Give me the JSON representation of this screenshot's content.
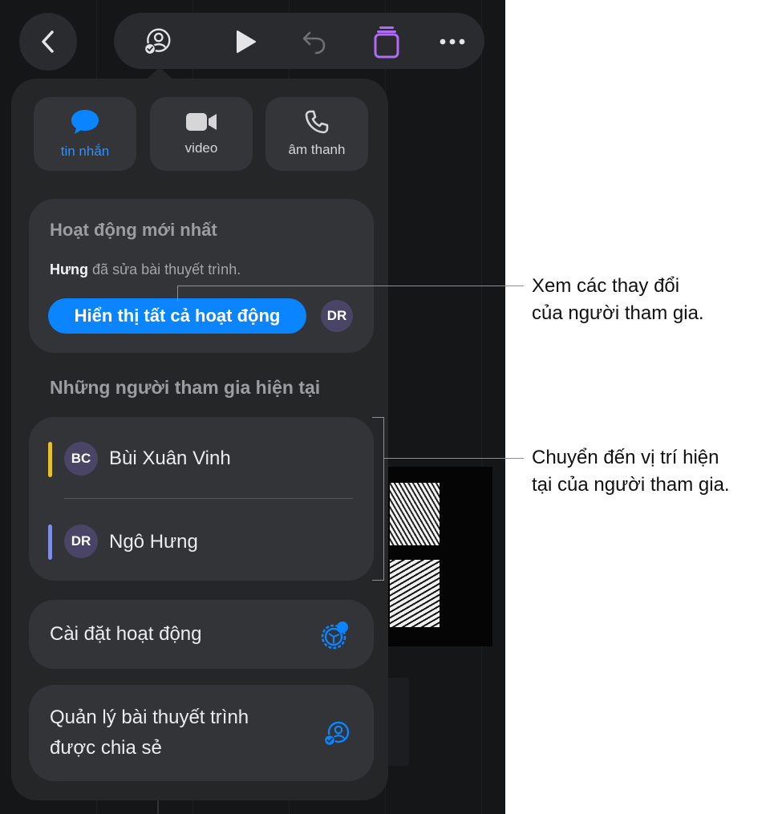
{
  "colors": {
    "accent": "#0a84ff",
    "presence_vinh": "#e6c12c",
    "presence_hung": "#7c8fe0",
    "purple_icon": "#b06bf4"
  },
  "toolbar": {
    "icons": [
      "back-chevron-icon",
      "collaboration-icon",
      "play-icon",
      "undo-icon",
      "slides-icon",
      "more-icon"
    ]
  },
  "comm": {
    "message_label": "tin nhắn",
    "video_label": "video",
    "audio_label": "âm thanh"
  },
  "activity": {
    "title": "Hoạt động mới nhất",
    "actor": "Hưng",
    "action": "đã sửa bài thuyết trình.",
    "show_all_label": "Hiển thị tất cả hoạt động",
    "avatar_initials": "DR"
  },
  "participants": {
    "title": "Những người tham gia hiện tại",
    "list": [
      {
        "initials": "BC",
        "name": "Bùi Xuân Vinh"
      },
      {
        "initials": "DR",
        "name": "Ngô Hưng"
      }
    ]
  },
  "settings": {
    "activity_settings_label": "Cài đặt hoạt động",
    "manage_line1": "Quản lý bài thuyết trình",
    "manage_line2": "được chia sẻ"
  },
  "callouts": {
    "first_line1": "Xem các thay đổi",
    "first_line2": "của người tham gia.",
    "second_line1": "Chuyển đến vị trí hiện",
    "second_line2": "tại của người tham gia."
  }
}
